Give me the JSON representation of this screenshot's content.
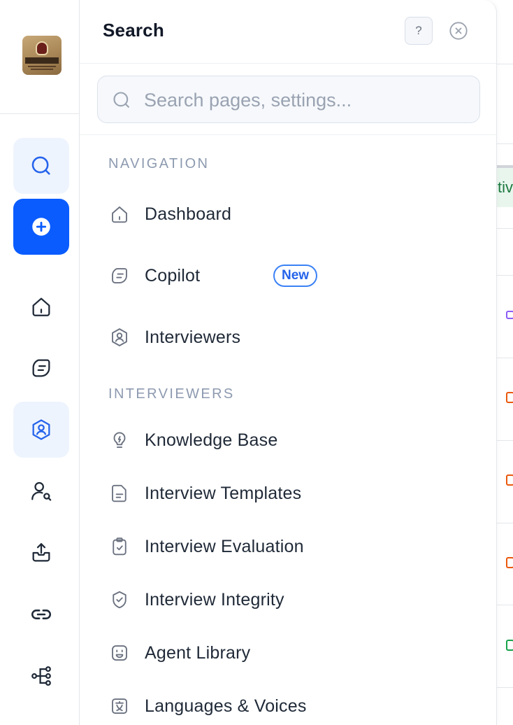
{
  "panel": {
    "title": "Search",
    "help_label": "?",
    "search_placeholder": "Search pages, settings..."
  },
  "sections": [
    {
      "heading": "NAVIGATION",
      "items": [
        {
          "label": "Dashboard",
          "icon": "home-icon"
        },
        {
          "label": "Copilot",
          "icon": "copilot-icon",
          "badge": "New"
        },
        {
          "label": "Interviewers",
          "icon": "interviewer-icon"
        }
      ]
    },
    {
      "heading": "INTERVIEWERS",
      "items": [
        {
          "label": "Knowledge Base",
          "icon": "lightbulb-icon"
        },
        {
          "label": "Interview Templates",
          "icon": "document-icon"
        },
        {
          "label": "Interview Evaluation",
          "icon": "clipboard-check-icon"
        },
        {
          "label": "Interview Integrity",
          "icon": "shield-check-icon"
        },
        {
          "label": "Agent Library",
          "icon": "robot-face-icon"
        },
        {
          "label": "Languages & Voices",
          "icon": "translate-icon"
        }
      ]
    }
  ],
  "rail": {
    "logo": "IACOVELI",
    "buttons": [
      "search-icon",
      "add-icon",
      "home-icon",
      "copilot-icon",
      "interviewer-icon",
      "user-search-icon",
      "inbox-upload-icon",
      "link-icon",
      "workflow-icon"
    ]
  },
  "background": {
    "chip_text": "tiv"
  },
  "colors": {
    "accent": "#0a5cff",
    "badge": "#2563eb",
    "section_heading": "#8d9ab0"
  }
}
